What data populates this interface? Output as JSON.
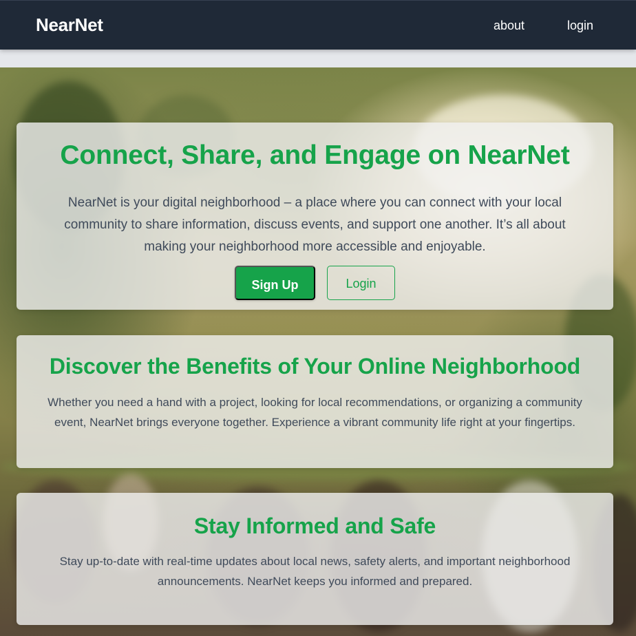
{
  "navbar": {
    "brand": "NearNet",
    "links": [
      {
        "label": "about"
      },
      {
        "label": "login"
      }
    ],
    "background": "#1f2937"
  },
  "hero": {
    "title": "Connect, Share, and Engage on NearNet",
    "description": "NearNet is your digital neighborhood – a place where you can connect with your local community to share information, discuss events, and support one another. It’s all about making your neighborhood more accessible and enjoyable.",
    "signup_label": "Sign Up",
    "login_label": "Login"
  },
  "benefits": {
    "title": "Discover the Benefits of Your Online Neighborhood",
    "description": "Whether you need a hand with a project, looking for local recommendations, or organizing a community event, NearNet brings everyone together. Experience a vibrant community life right at your fingertips."
  },
  "safety": {
    "title": "Stay Informed and Safe",
    "description": "Stay up-to-date with real-time updates about local news, safety alerts, and important neighborhood announcements. NearNet keeps you informed and prepared."
  },
  "colors": {
    "accent": "#16a34a",
    "text": "#3f4a5a",
    "card": "#f0f0f0"
  }
}
